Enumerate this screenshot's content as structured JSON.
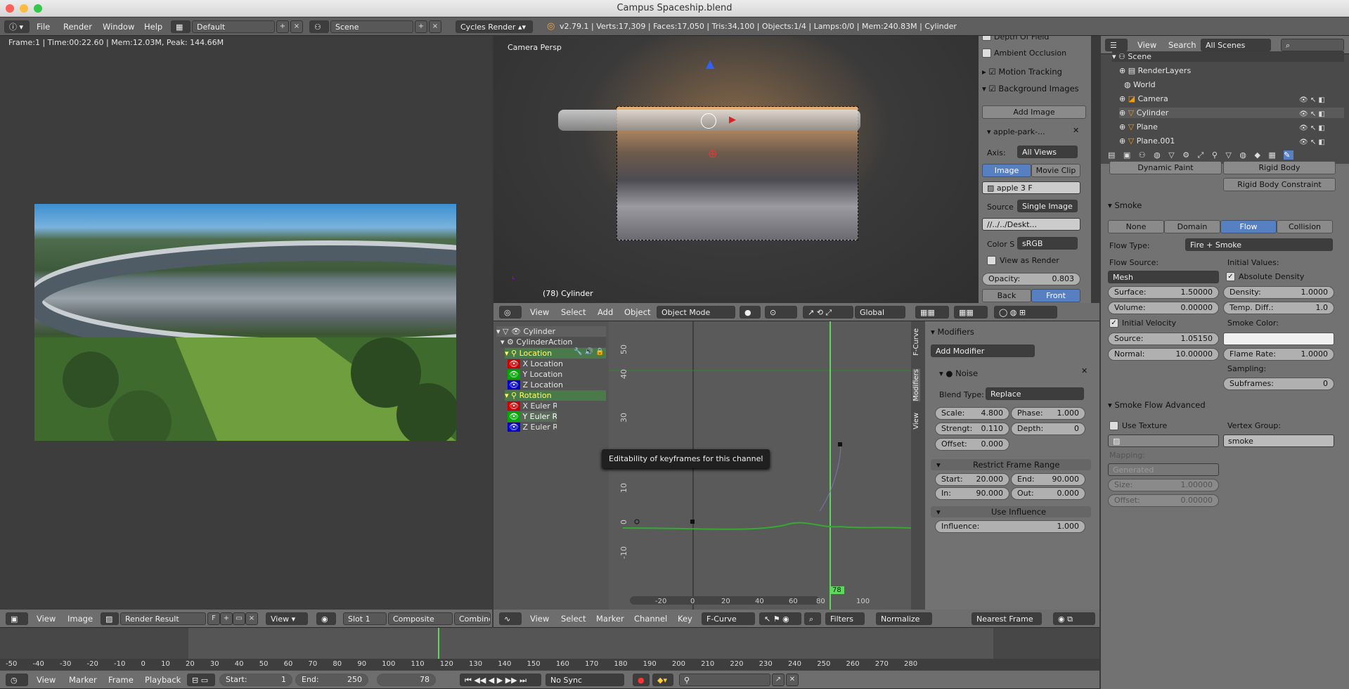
{
  "window": {
    "title": "Campus Spaceship.blend"
  },
  "info_header": {
    "menus": [
      "File",
      "Render",
      "Window",
      "Help"
    ],
    "layout": "Default",
    "scene": "Scene",
    "engine": "Cycles Render",
    "stats": "v2.79.1 | Verts:17,309 | Faces:17,050 | Tris:34,100 | Objects:1/4 | Lamps:0/0 | Mem:240.83M | Cylinder"
  },
  "image_editor": {
    "status": "Frame:1 | Time:00:22.60 | Mem:12.03M, Peak: 144.66M",
    "menus": [
      "View",
      "Image"
    ],
    "image_name": "Render Result",
    "f_label": "F",
    "view_label": "View",
    "slot": "Slot 1",
    "pass": "Composite",
    "combined": "Combined"
  },
  "viewport": {
    "label": "Camera Persp",
    "object_label": "(78) Cylinder",
    "menus": [
      "View",
      "Select",
      "Add",
      "Object"
    ],
    "mode": "Object Mode",
    "orientation": "Global"
  },
  "bg_images": {
    "rows": [
      "Depth Of Field",
      "Ambient Occlusion",
      "Motion Tracking",
      "Background Images"
    ],
    "add_image": "Add Image",
    "image_name": "apple-park-...",
    "axis_label": "Axis:",
    "axis_value": "All Views",
    "tabs": [
      "Image",
      "Movie Clip"
    ],
    "img_field": "apple",
    "img_users": "3",
    "img_f": "F",
    "source_label": "Source",
    "source_value": "Single Image",
    "path": "//../../Deskt...",
    "color_label": "Color S",
    "color_value": "sRGB",
    "view_as_render": "View as Render",
    "opacity_label": "Opacity:",
    "opacity_value": "0.803",
    "back": "Back",
    "front": "Front"
  },
  "graph": {
    "channels": [
      {
        "name": "Cylinder"
      },
      {
        "name": "CylinderAction"
      },
      {
        "name": "Location"
      },
      {
        "name": "X Location"
      },
      {
        "name": "Y Location"
      },
      {
        "name": "Z Location"
      },
      {
        "name": "Rotation"
      },
      {
        "name": "X Euler Rotation"
      },
      {
        "name": "Y Euler Rotation"
      },
      {
        "name": "Z Euler Rotation"
      }
    ],
    "tooltip": "Editability of keyframes for this channel",
    "y_ticks": [
      "50",
      "40",
      "30",
      "20",
      "10",
      "0",
      "-10"
    ],
    "x_ticks": [
      "-20",
      "0",
      "20",
      "40",
      "60",
      "80",
      "100"
    ],
    "current_frame": "78",
    "menus": [
      "View",
      "Select",
      "Marker",
      "Channel",
      "Key"
    ],
    "mode": "F-Curve",
    "filters": "Filters",
    "normalize": "Normalize",
    "snap": "Nearest Frame",
    "side_tabs": [
      "F-Curve",
      "Modifiers",
      "View"
    ]
  },
  "modifiers": {
    "title": "Modifiers",
    "add": "Add Modifier",
    "noise": "Noise",
    "blend_label": "Blend Type:",
    "blend_value": "Replace",
    "scale": [
      "Scale:",
      "4.800"
    ],
    "phase": [
      "Phase:",
      "1.000"
    ],
    "strength": [
      "Strengt:",
      "0.110"
    ],
    "depth": [
      "Depth:",
      "0"
    ],
    "offset": [
      "Offset:",
      "0.000"
    ],
    "restrict": "Restrict Frame Range",
    "start": [
      "Start:",
      "20.000"
    ],
    "end": [
      "End:",
      "90.000"
    ],
    "in": [
      "In:",
      "90.000"
    ],
    "out": [
      "Out:",
      "0.000"
    ],
    "use_influence": "Use Influence",
    "influence": [
      "Influence:",
      "1.000"
    ]
  },
  "outliner": {
    "menus": [
      "View",
      "Search"
    ],
    "filter": "All Scenes",
    "items": [
      "Scene",
      "RenderLayers",
      "World",
      "Camera",
      "Cylinder",
      "Plane",
      "Plane.001"
    ]
  },
  "physics": {
    "dynamic_paint": "Dynamic Paint",
    "rigid_body": "Rigid Body",
    "rigid_body_constraint": "Rigid Body Constraint",
    "smoke": "Smoke",
    "types": [
      "None",
      "Domain",
      "Flow",
      "Collision"
    ],
    "flow_type_label": "Flow Type:",
    "flow_type": "Fire + Smoke",
    "flow_source_label": "Flow Source:",
    "initial_values": "Initial Values:",
    "mesh": "Mesh",
    "absolute_density": "Absolute Density",
    "surface": [
      "Surface:",
      "1.50000"
    ],
    "density": [
      "Density:",
      "1.0000"
    ],
    "volume": [
      "Volume:",
      "0.00000"
    ],
    "temp": [
      "Temp. Diff.:",
      "1.0"
    ],
    "initial_velocity": "Initial Velocity",
    "smoke_color": "Smoke Color:",
    "source": [
      "Source:",
      "1.05150"
    ],
    "normal": [
      "Normal:",
      "10.00000"
    ],
    "flame_rate": [
      "Flame Rate:",
      "1.0000"
    ],
    "sampling": "Sampling:",
    "subframes": [
      "Subframes:",
      "0"
    ],
    "advanced": "Smoke Flow Advanced",
    "use_texture": "Use Texture",
    "vertex_group": "Vertex Group:",
    "vg_value": "smoke",
    "mapping": "Mapping:",
    "generated": "Generated",
    "size": [
      "Size:",
      "1.00000"
    ],
    "offset": [
      "Offset:",
      "0.00000"
    ]
  },
  "timeline": {
    "ticks": [
      "-50",
      "-40",
      "-30",
      "-20",
      "-10",
      "0",
      "10",
      "20",
      "30",
      "40",
      "50",
      "60",
      "70",
      "80",
      "90",
      "100",
      "110",
      "120",
      "130",
      "140",
      "150",
      "160",
      "170",
      "180",
      "190",
      "200",
      "210",
      "220",
      "230",
      "240",
      "250",
      "260",
      "270",
      "280"
    ],
    "menus": [
      "View",
      "Marker",
      "Frame",
      "Playback"
    ],
    "start": [
      "Start:",
      "1"
    ],
    "end": [
      "End:",
      "250"
    ],
    "frame": "78",
    "sync": "No Sync"
  }
}
